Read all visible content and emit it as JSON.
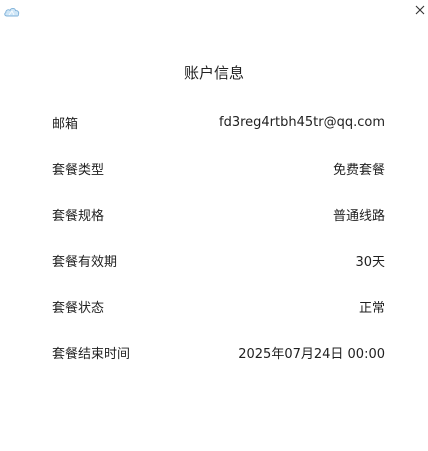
{
  "window": {
    "app_icon": "cloud-icon",
    "close_icon": "close-icon"
  },
  "page": {
    "title": "账户信息"
  },
  "account_rows": [
    {
      "label": "邮箱",
      "value": "fd3reg4rtbh45tr@qq.com"
    },
    {
      "label": "套餐类型",
      "value": "免费套餐"
    },
    {
      "label": "套餐规格",
      "value": "普通线路"
    },
    {
      "label": "套餐有效期",
      "value": "30天"
    },
    {
      "label": "套餐状态",
      "value": "正常"
    },
    {
      "label": "套餐结束时间",
      "value": "2025年07月24日 00:00"
    }
  ]
}
